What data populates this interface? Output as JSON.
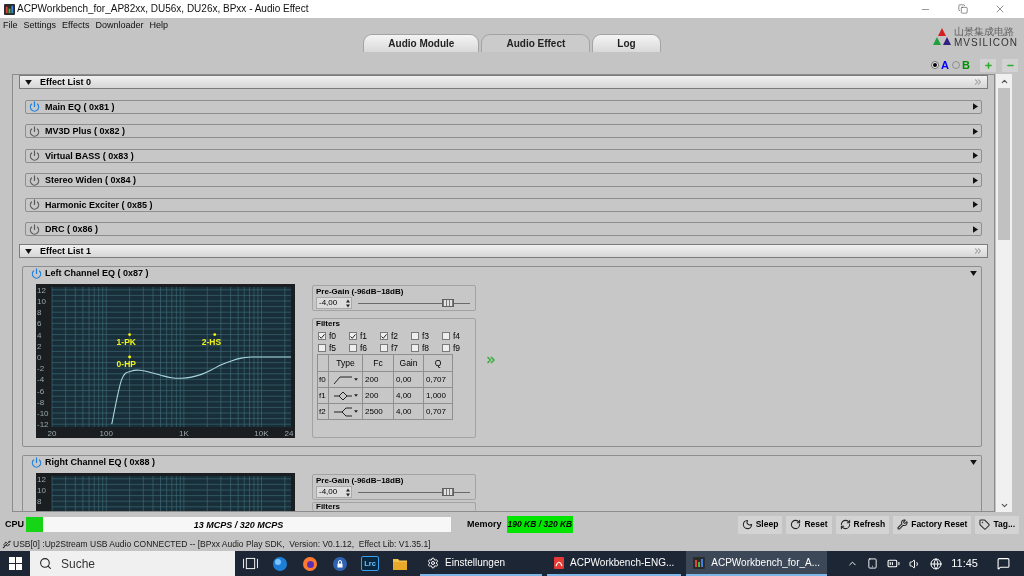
{
  "window": {
    "title": "ACPWorkbench_for_AP82xx, DU56x, DU26x, BPxx - Audio Effect"
  },
  "menu": [
    "File",
    "Settings",
    "Effects",
    "Downloader",
    "Help"
  ],
  "tabs": [
    {
      "label": "Audio Module",
      "selected": false
    },
    {
      "label": "Audio Effect",
      "selected": true
    },
    {
      "label": "Log",
      "selected": false
    }
  ],
  "logo": {
    "chinese": "山景集成电路",
    "latin": "MVSILICON"
  },
  "preset_select": [
    {
      "label": "A",
      "selected": true,
      "color": "#0000ff"
    },
    {
      "label": "B",
      "selected": false,
      "color": "#009000"
    }
  ],
  "effect_lists": [
    {
      "title": "Effect List 0",
      "expanded": true,
      "effects": [
        {
          "name": "Main EQ ( 0x81 )",
          "on": true,
          "expanded": false
        },
        {
          "name": "MV3D Plus ( 0x82 )",
          "on": false,
          "expanded": false
        },
        {
          "name": "Virtual BASS ( 0x83 )",
          "on": false,
          "expanded": false
        },
        {
          "name": "Stereo Widen ( 0x84 )",
          "on": false,
          "expanded": false
        },
        {
          "name": "Harmonic Exciter ( 0x85 )",
          "on": false,
          "expanded": false
        },
        {
          "name": "DRC ( 0x86 )",
          "on": false,
          "expanded": false
        }
      ]
    },
    {
      "title": "Effect List 1",
      "expanded": true,
      "effects": [
        {
          "name": "Left Channel EQ ( 0x87 )",
          "on": true,
          "expanded": true,
          "eq": {
            "chart_data": {
              "type": "line",
              "categories": [
                null,
                null,
                null,
                null,
                null,
                null,
                null,
                null,
                null,
                null,
                null,
                null,
                null,
                null,
                null,
                null,
                null,
                null,
                null,
                null,
                null,
                null,
                null,
                null,
                null
              ],
              "series": [
                {
                  "color": "#a9d6df",
                  "values": [
                    null,
                    null,
                    null,
                    null,
                    null,
                    null,
                    -12,
                    -4,
                    -2.5,
                    -2.4,
                    -2.8,
                    -3.3,
                    -3.7,
                    -3.8,
                    -3.6,
                    -3.1,
                    -2.3,
                    -1.4,
                    -0.7,
                    -0.2,
                    0,
                    0,
                    0,
                    0,
                    0
                  ]
                }
              ],
              "ylim": [
                -12.5,
                12.5
              ],
              "yticks": [
                12,
                10,
                8,
                6,
                4,
                2,
                0,
                -2,
                -4,
                -6,
                -8,
                -10,
                -12
              ],
              "grid": true,
              "annotations": [
                "0-HP",
                "1-PK",
                "2-HS"
              ]
            },
            "x_labels": [
              "20",
              "100",
              "1K",
              "10K",
              "24"
            ],
            "pre_gain": {
              "label": "Pre-Gain (-96dB~18dB)",
              "value": "-4,00",
              "level": 0.8
            },
            "filters_label": "Filters",
            "filters": [
              {
                "label": "f0",
                "checked": true
              },
              {
                "label": "f1",
                "checked": true
              },
              {
                "label": "f2",
                "checked": true
              },
              {
                "label": "f3",
                "checked": false
              },
              {
                "label": "f4",
                "checked": false
              },
              {
                "label": "f5",
                "checked": false
              },
              {
                "label": "f6",
                "checked": false
              },
              {
                "label": "f7",
                "checked": false
              },
              {
                "label": "f8",
                "checked": false
              },
              {
                "label": "f9",
                "checked": false
              }
            ],
            "table": {
              "columns": [
                "Type",
                "Fc",
                "Gain",
                "Q"
              ],
              "rows": [
                {
                  "label": "f0",
                  "kind": "highpass",
                  "fc": "200",
                  "gain": "0,00",
                  "q": "0,707"
                },
                {
                  "label": "f1",
                  "kind": "peak",
                  "fc": "200",
                  "gain": "4,00",
                  "q": "1,000"
                },
                {
                  "label": "f2",
                  "kind": "highshelf",
                  "fc": "2500",
                  "gain": "4,00",
                  "q": "0,707"
                }
              ]
            }
          }
        },
        {
          "name": "Right Channel EQ ( 0x88 )",
          "on": true,
          "expanded": true,
          "eq": {
            "graph": {
              "y_labels": [
                "12",
                "10",
                "8"
              ]
            },
            "pre_gain": {
              "label": "Pre-Gain (-96dB~18dB)",
              "value": "-4,00",
              "level": 0.8
            },
            "filters_label": "Filters"
          }
        }
      ]
    }
  ],
  "bottom_bar": {
    "cpu": {
      "label": "CPU",
      "level": 0.04,
      "reading": "13 MCPS / 320 MCPS"
    },
    "memory": {
      "label": "Memory",
      "reading": "190 KB / 320 KB"
    },
    "buttons": [
      "Sleep",
      "Reset",
      "Refresh",
      "Factory Reset",
      "Tag..."
    ]
  },
  "status_bar": {
    "text": "USB[0] :Up2Stream USB Audio CONNECTED -- [BPxx Audio Play SDK,  Version: V0.1.12,  Effect Lib: V1.35.1]"
  },
  "taskbar": {
    "search": {
      "placeholder": "Suche"
    },
    "app_tile": "Lrc",
    "windows": [
      {
        "label": "Einstellungen",
        "kind": "settings",
        "selected": false
      },
      {
        "label": "ACPWorkbench-ENG...",
        "kind": "pdf",
        "selected": false
      },
      {
        "label": "ACPWorkbench_for_A...",
        "kind": "app",
        "selected": true
      }
    ],
    "clock": "11:45"
  }
}
